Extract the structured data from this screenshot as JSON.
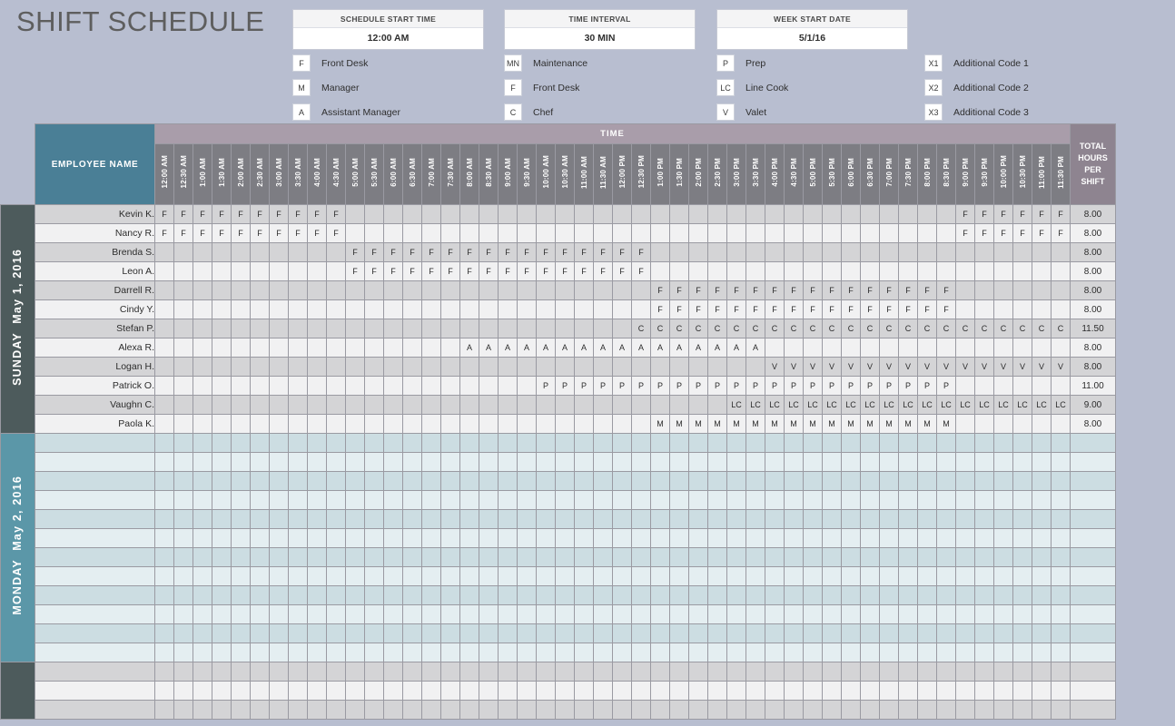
{
  "header": {
    "title": "SHIFT SCHEDULE",
    "params": [
      {
        "label": "SCHEDULE START TIME",
        "value": "12:00 AM"
      },
      {
        "label": "TIME INTERVAL",
        "value": "30 MIN"
      },
      {
        "label": "WEEK START DATE",
        "value": "5/1/16"
      }
    ],
    "legend": [
      [
        {
          "code": "F",
          "text": "Front Desk"
        },
        {
          "code": "M",
          "text": "Manager"
        },
        {
          "code": "A",
          "text": "Assistant Manager"
        }
      ],
      [
        {
          "code": "MN",
          "text": "Maintenance"
        },
        {
          "code": "F",
          "text": "Front Desk"
        },
        {
          "code": "C",
          "text": "Chef"
        }
      ],
      [
        {
          "code": "P",
          "text": "Prep"
        },
        {
          "code": "LC",
          "text": "Line Cook"
        },
        {
          "code": "V",
          "text": "Valet"
        }
      ],
      [
        {
          "code": "X1",
          "text": "Additional Code 1"
        },
        {
          "code": "X2",
          "text": "Additional Code 2"
        },
        {
          "code": "X3",
          "text": "Additional Code 3"
        }
      ]
    ]
  },
  "table": {
    "employee_header": "EMPLOYEE NAME",
    "time_header": "TIME",
    "total_header_lines": [
      "TOTAL",
      "HOURS",
      "PER",
      "SHIFT"
    ],
    "time_slots": [
      "12:00 AM",
      "12:30 AM",
      "1:00 AM",
      "1:30 AM",
      "2:00 AM",
      "2:30 AM",
      "3:00 AM",
      "3:30 AM",
      "4:00 AM",
      "4:30 AM",
      "5:00 AM",
      "5:30 AM",
      "6:00 AM",
      "6:30 AM",
      "7:00 AM",
      "7:30 AM",
      "8:00 AM",
      "8:30 AM",
      "9:00 AM",
      "9:30 AM",
      "10:00 AM",
      "10:30 AM",
      "11:00 AM",
      "11:30 AM",
      "12:00 PM",
      "12:30 PM",
      "1:00 PM",
      "1:30 PM",
      "2:00 PM",
      "2:30 PM",
      "3:00 PM",
      "3:30 PM",
      "4:00 PM",
      "4:30 PM",
      "5:00 PM",
      "5:30 PM",
      "6:00 PM",
      "6:30 PM",
      "7:00 PM",
      "7:30 PM",
      "8:00 PM",
      "8:30 PM",
      "9:00 PM",
      "9:30 PM",
      "10:00 PM",
      "10:30 PM",
      "11:00 PM",
      "11:30 PM"
    ],
    "days": [
      {
        "name": "SUNDAY",
        "date": "May 1, 2016",
        "theme": "sunday",
        "rows": [
          {
            "name": "Kevin K.",
            "total": "8.00",
            "spans": [
              {
                "code": "F",
                "from": 0,
                "to": 9
              },
              {
                "code": "F",
                "from": 42,
                "to": 47
              }
            ]
          },
          {
            "name": "Nancy R.",
            "total": "8.00",
            "spans": [
              {
                "code": "F",
                "from": 0,
                "to": 9
              },
              {
                "code": "F",
                "from": 42,
                "to": 47
              }
            ]
          },
          {
            "name": "Brenda S.",
            "total": "8.00",
            "spans": [
              {
                "code": "F",
                "from": 10,
                "to": 25
              }
            ]
          },
          {
            "name": "Leon A.",
            "total": "8.00",
            "spans": [
              {
                "code": "F",
                "from": 10,
                "to": 25
              }
            ]
          },
          {
            "name": "Darrell R.",
            "total": "8.00",
            "spans": [
              {
                "code": "F",
                "from": 26,
                "to": 41
              }
            ]
          },
          {
            "name": "Cindy Y.",
            "total": "8.00",
            "spans": [
              {
                "code": "F",
                "from": 26,
                "to": 41
              }
            ]
          },
          {
            "name": "Stefan P.",
            "total": "11.50",
            "spans": [
              {
                "code": "C",
                "from": 25,
                "to": 47
              }
            ]
          },
          {
            "name": "Alexa R.",
            "total": "8.00",
            "spans": [
              {
                "code": "A",
                "from": 16,
                "to": 31
              }
            ]
          },
          {
            "name": "Logan H.",
            "total": "8.00",
            "spans": [
              {
                "code": "V",
                "from": 32,
                "to": 47
              }
            ]
          },
          {
            "name": "Patrick O.",
            "total": "11.00",
            "spans": [
              {
                "code": "P",
                "from": 20,
                "to": 41
              }
            ]
          },
          {
            "name": "Vaughn C.",
            "total": "9.00",
            "spans": [
              {
                "code": "LC",
                "from": 30,
                "to": 47
              }
            ]
          },
          {
            "name": "Paola K.",
            "total": "8.00",
            "spans": [
              {
                "code": "M",
                "from": 26,
                "to": 41
              }
            ]
          }
        ]
      },
      {
        "name": "MONDAY",
        "date": "May 2, 2016",
        "theme": "monday",
        "rows": [
          {
            "name": "",
            "total": "",
            "spans": []
          },
          {
            "name": "",
            "total": "",
            "spans": []
          },
          {
            "name": "",
            "total": "",
            "spans": []
          },
          {
            "name": "",
            "total": "",
            "spans": []
          },
          {
            "name": "",
            "total": "",
            "spans": []
          },
          {
            "name": "",
            "total": "",
            "spans": []
          },
          {
            "name": "",
            "total": "",
            "spans": []
          },
          {
            "name": "",
            "total": "",
            "spans": []
          },
          {
            "name": "",
            "total": "",
            "spans": []
          },
          {
            "name": "",
            "total": "",
            "spans": []
          },
          {
            "name": "",
            "total": "",
            "spans": []
          },
          {
            "name": "",
            "total": "",
            "spans": []
          }
        ]
      },
      {
        "name": "",
        "date": "",
        "theme": "blank",
        "rows": [
          {
            "name": "",
            "total": "",
            "spans": []
          },
          {
            "name": "",
            "total": "",
            "spans": []
          },
          {
            "name": "",
            "total": "",
            "spans": []
          }
        ]
      }
    ]
  }
}
